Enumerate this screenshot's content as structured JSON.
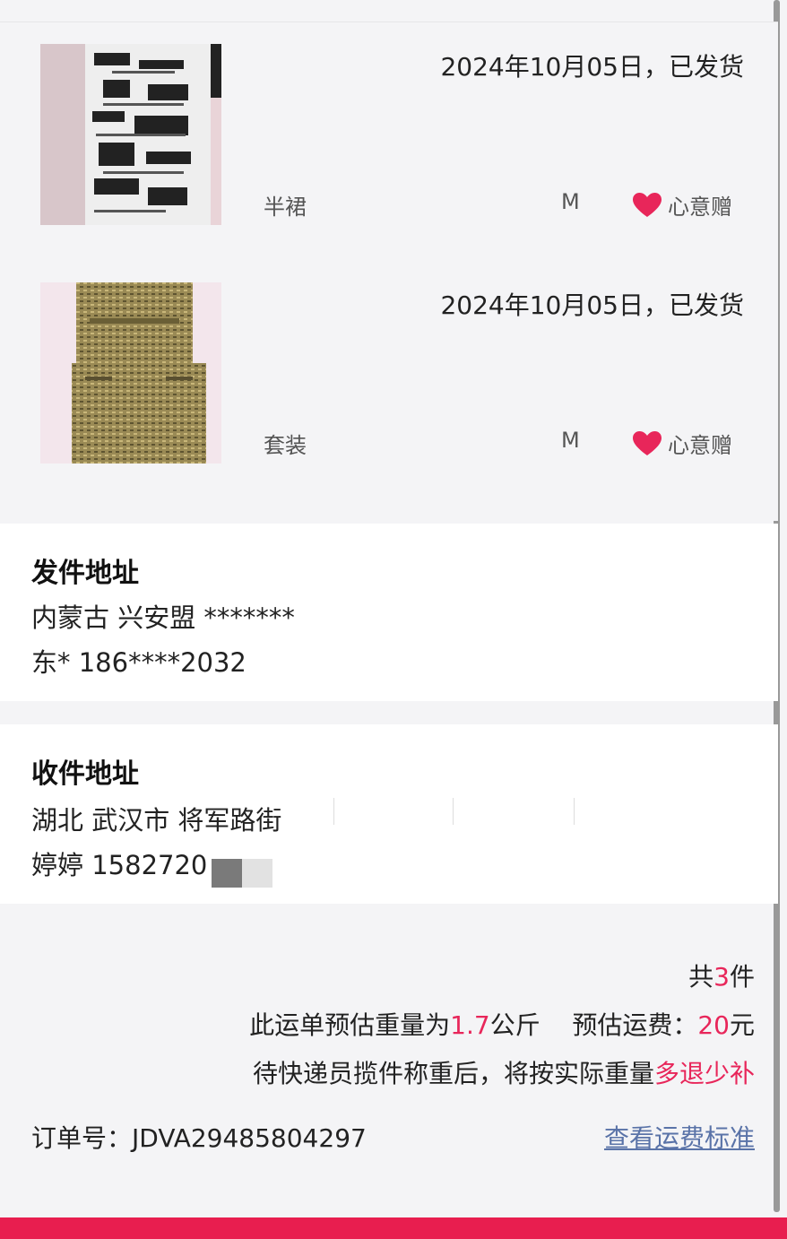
{
  "items": [
    {
      "date": "2024年10月05日，已发货",
      "category": "半裙",
      "size": "M",
      "gift": "心意赠",
      "image_desc": "printed-skirt"
    },
    {
      "date": "2024年10月05日，已发货",
      "category": "套装",
      "size": "M",
      "gift": "心意赠",
      "image_desc": "tweed-set"
    }
  ],
  "sender": {
    "title": "发件地址",
    "line1": "内蒙古 兴安盟 *******",
    "line2": "东* 186****2032"
  },
  "receiver": {
    "title": "收件地址",
    "line1": "湖北 武汉市 将军路街",
    "line2": "婷婷 1582720"
  },
  "summary": {
    "count_prefix": "共",
    "count": "3",
    "count_suffix": "件",
    "weight_prefix": "此运单预估重量为",
    "weight": "1.7",
    "weight_unit": "公斤",
    "fee_label": "预估运费：",
    "fee": "20",
    "fee_unit": "元",
    "note_prefix": "待快递员揽件称重后，将按实际重量",
    "note_highlight": "多退少补"
  },
  "order": {
    "label": "订单号：",
    "number": "JDVA29485804297",
    "link": "查看运费标准"
  },
  "colors": {
    "accent": "#e8265a",
    "link": "#5a73a8",
    "bar": "#e81e4f"
  }
}
